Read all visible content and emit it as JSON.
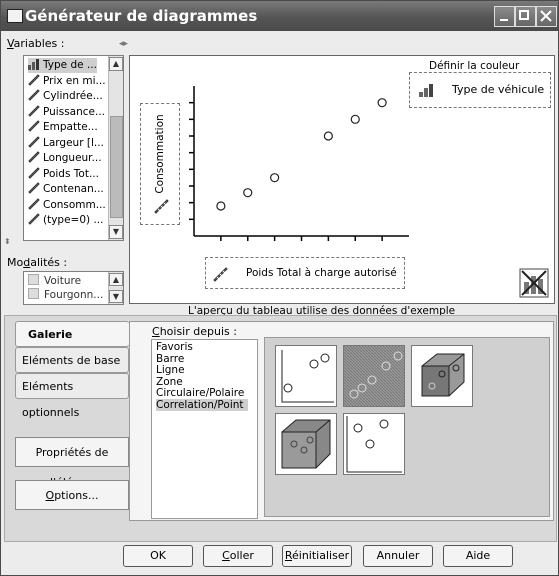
{
  "window": {
    "title": "Générateur de diagrammes"
  },
  "variables": {
    "label": "Variables :",
    "items": [
      "Type de ...",
      "Prix en mi...",
      "Cylindrée...",
      "Puissance...",
      "Empatte...",
      "Largeur [l...",
      "Longueur...",
      "Poids Tot...",
      "Contenan...",
      "Consomm...",
      "(type=0) ..."
    ]
  },
  "modalites": {
    "label": "Modalités :",
    "items": [
      "Voiture",
      "Fourgonn..."
    ]
  },
  "chart_preview": {
    "color_label": "Définir la couleur",
    "color_variable": "Type de véhicule",
    "y_variable": "Consommation",
    "x_variable": "Poids Total à charge autorisé",
    "note": "L'aperçu du tableau utilise des données d'exemple"
  },
  "chart_data": {
    "type": "scatter",
    "title": "",
    "xlabel": "Poids Total à charge autorisé",
    "ylabel": "Consommation",
    "x": [
      1,
      2,
      3,
      5,
      6,
      7
    ],
    "y": [
      1.8,
      2.6,
      3.5,
      6.0,
      7.0,
      8.0
    ],
    "grid": false
  },
  "tabs": [
    {
      "label": "Galerie",
      "active": true
    },
    {
      "label": "Eléments de base",
      "active": false
    },
    {
      "label": "Eléments optionnels",
      "active": false
    }
  ],
  "side_buttons": {
    "properties": "Propriétés de l'élém...",
    "options": "Options..."
  },
  "gallery": {
    "choose_label": "Choisir depuis :",
    "categories": [
      "Favoris",
      "Barre",
      "Ligne",
      "Zone",
      "Circulaire/Polaire",
      "Correlation/Point"
    ],
    "selected": "Correlation/Point"
  },
  "buttons": {
    "ok": "OK",
    "coller": "Coller",
    "reinit": "Réinitialiser",
    "annuler": "Annuler",
    "aide": "Aide"
  },
  "colors": {
    "titlebar": "#555555",
    "dialog": "#ececec",
    "selection": "#cfcfcf"
  }
}
